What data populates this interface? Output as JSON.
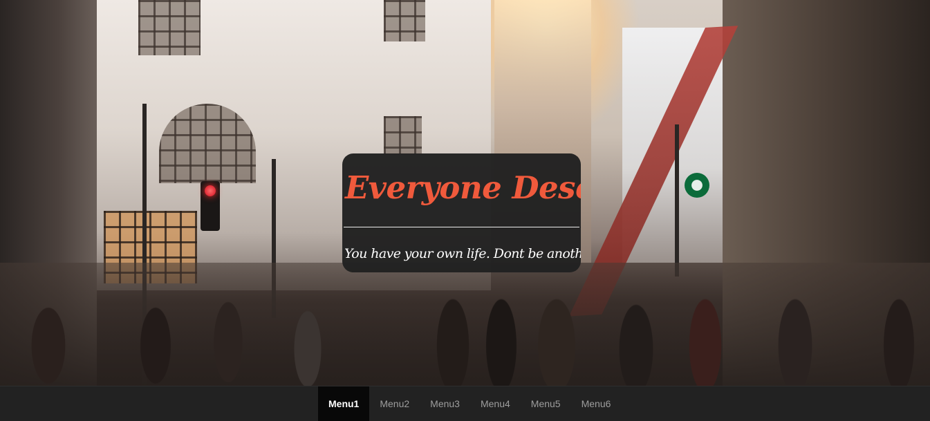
{
  "hero": {
    "background_image": "city-street-crowd-photo",
    "title": "Everyone Deserves",
    "subtitle": "You have your own life. Dont be another!",
    "title_color": "#f05a3c",
    "card_background": "#212121"
  },
  "nav": {
    "items": [
      {
        "label": "Menu1",
        "active": true
      },
      {
        "label": "Menu2",
        "active": false
      },
      {
        "label": "Menu3",
        "active": false
      },
      {
        "label": "Menu4",
        "active": false
      },
      {
        "label": "Menu5",
        "active": false
      },
      {
        "label": "Menu6",
        "active": false
      }
    ],
    "background": "#222222",
    "active_background": "#080808"
  }
}
